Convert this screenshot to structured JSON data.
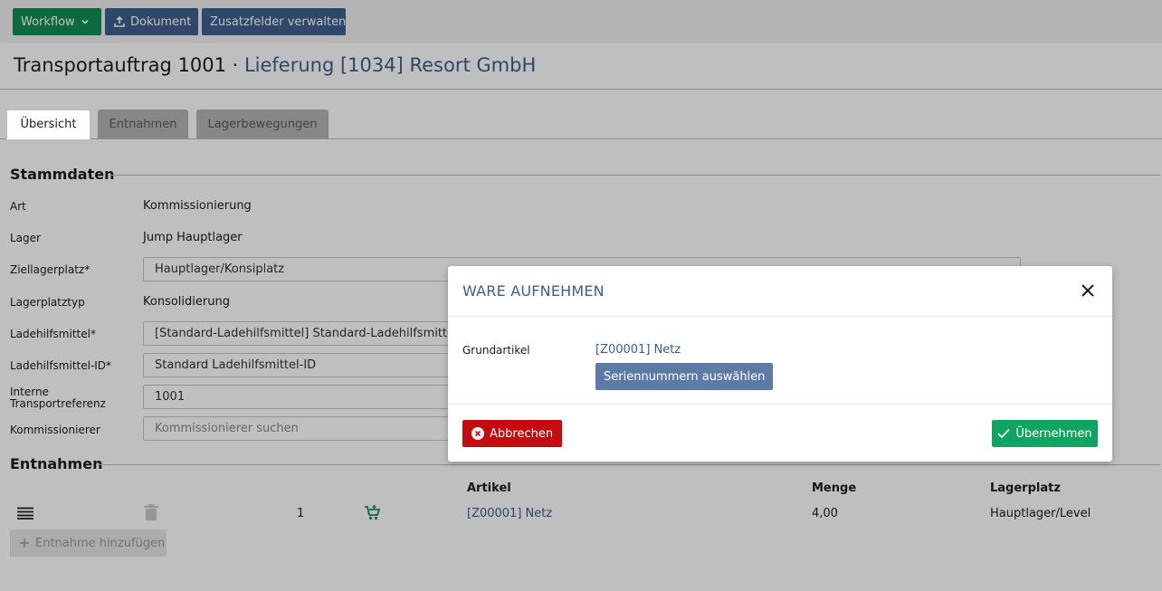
{
  "toolbar": {
    "workflow_label": "Workflow",
    "dokument_label": "Dokument",
    "zusatzfelder_label": "Zusatzfelder verwalten"
  },
  "header": {
    "title": "Transportauftrag 1001 · ",
    "subtitle": "Lieferung [1034] Resort GmbH"
  },
  "tabs": [
    {
      "label": "Übersicht",
      "active": true
    },
    {
      "label": "Entnahmen",
      "active": false
    },
    {
      "label": "Lagerbewegungen",
      "active": false
    }
  ],
  "stammdaten": {
    "heading": "Stammdaten",
    "art_label": "Art",
    "art_value": "Kommissionierung",
    "lager_label": "Lager",
    "lager_value": "Jump Hauptlager",
    "ziellagerplatz_label": "Ziellagerplatz*",
    "ziellagerplatz_value": "Hauptlager/Konsiplatz",
    "lagerplatztyp_label": "Lagerplatztyp",
    "lagerplatztyp_value": "Konsolidierung",
    "ladehilfsmittel_label": "Ladehilfsmittel*",
    "ladehilfsmittel_value": "[Standard-Ladehilfsmittel] Standard-Ladehilfsmittel",
    "ladehilfsmittel_id_label": "Ladehilfsmittel-ID*",
    "ladehilfsmittel_id_value": "Standard Ladehilfsmittel-ID",
    "interne_label_1": "Interne",
    "interne_label_2": "Transportreferenz",
    "interne_value": "1001",
    "kommissionierer_label": "Kommissionierer",
    "kommissionierer_placeholder": "Kommissionierer suchen"
  },
  "entnahmen": {
    "heading": "Entnahmen",
    "columns": {
      "artikel": "Artikel",
      "menge": "Menge",
      "lagerplatz": "Lagerplatz"
    },
    "rows": [
      {
        "pos": "1",
        "artikel": "[Z00001] Netz",
        "menge": "4,00",
        "lagerplatz": "Hauptlager/Level"
      }
    ],
    "add_label": "Entnahme hinzufügen"
  },
  "modal": {
    "title": "WARE AUFNEHMEN",
    "grundartikel_label": "Grundartikel",
    "grundartikel_value": "[Z00001] Netz",
    "serial_button": "Seriennummern auswählen",
    "cancel_button": "Abbrechen",
    "ok_button": "Übernehmen"
  },
  "colors": {
    "green": "#0f8f55",
    "blue": "#3f5f8f",
    "link": "#3d5f8c",
    "danger": "#c50a10",
    "success": "#10a462"
  },
  "icons": [
    "chevron-down-icon",
    "upload-icon",
    "menu-icon",
    "trash-icon",
    "cart-add-icon",
    "plus-icon",
    "close-icon",
    "cancel-circle-icon",
    "check-icon"
  ]
}
